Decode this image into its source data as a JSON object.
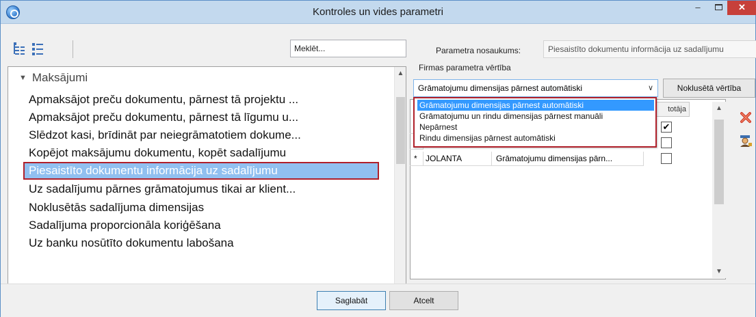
{
  "window": {
    "title": "Kontroles un vides parametri",
    "minimize_glyph": "–",
    "close_glyph": "✕"
  },
  "toolbar": {
    "search_value": "Meklēt...",
    "icons": [
      "tree-expand-icon",
      "tree-list-icon"
    ]
  },
  "tree": {
    "group": "Maksājumi",
    "items": [
      {
        "label": "Apmaksājot preču dokumentu, pārnest tā projektu ..."
      },
      {
        "label": "Apmaksājot preču dokumentu, pārnest tā līgumu u..."
      },
      {
        "label": "Slēdzot kasi, brīdināt par neiegrāmatotiem dokume..."
      },
      {
        "label": "Kopējot maksājumu dokumentu, kopēt sadalījumu"
      },
      {
        "label": "Piesaistīto dokumentu informācija uz sadalījumu",
        "selected": true
      },
      {
        "label": "Uz sadalījumu pārnes grāmatojumus tikai ar klient..."
      },
      {
        "label": "Noklusētās sadalījuma dimensijas"
      },
      {
        "label": "Sadalījuma proporcionāla koriģēšana"
      },
      {
        "label": "Uz banku nosūtīto dokumentu labošana"
      }
    ]
  },
  "param": {
    "name_label": "Parametra nosaukums:",
    "name_value": "Piesaistīto dokumentu informācija uz sadalījumu",
    "firm_value_label": "Firmas parametra vērtība",
    "combo_value": "Grāmatojumu dimensijas pārnest automātiski",
    "default_button": "Noklusētā vērtība"
  },
  "dropdown": {
    "options": [
      "Grāmatojumu dimensijas pārnest automātiski",
      "Grāmatojumu un rindu dimensijas pārnest manuāli",
      "Nepārnest",
      "Rindu dimensijas pārnest automātiski"
    ],
    "selected_index": 0
  },
  "grid": {
    "last_header": "totāja",
    "rows": [
      {
        "marker": "",
        "user": "",
        "value": "",
        "checked": true
      },
      {
        "marker": "",
        "user": "",
        "value": "",
        "checked": false
      },
      {
        "marker": "*",
        "user": "JOLANTA",
        "value": "Grāmatojumu dimensijas pārn...",
        "checked": false
      }
    ]
  },
  "footer": {
    "save": "Saglabāt",
    "cancel": "Atcelt"
  },
  "colors": {
    "selection_border": "#b0202a",
    "selection_fill": "#91c0f0",
    "dropdown_highlight": "#3399ff",
    "close_button": "#c7403a"
  }
}
